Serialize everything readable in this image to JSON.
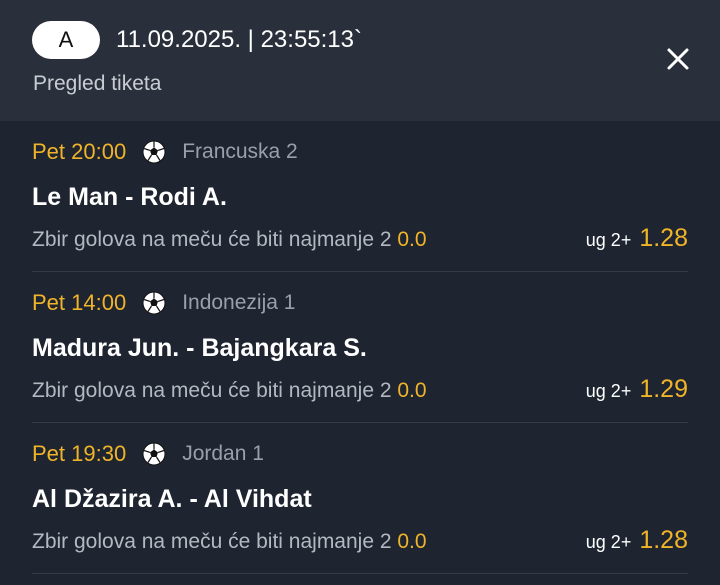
{
  "header": {
    "badge": "A",
    "datetime": "11.09.2025. | 23:55:13`",
    "subtitle": "Pregled tiketa"
  },
  "colors": {
    "accent": "#f0b429",
    "background": "#1e2430",
    "header": "#2a303b"
  },
  "icons": {
    "close": "close-icon",
    "sport": "soccer-ball-icon"
  },
  "matches": [
    {
      "time": "Pet 20:00",
      "league": "Francuska  2",
      "teams": "Le Man - Rodi A.",
      "market": "Zbir golova na meču će biti najmanje 2",
      "market_value": "0.0",
      "pick": "ug 2+",
      "odd": "1.28"
    },
    {
      "time": "Pet 14:00",
      "league": "Indonezija  1",
      "teams": "Madura Jun. - Bajangkara S.",
      "market": "Zbir golova na meču će biti najmanje 2",
      "market_value": "0.0",
      "pick": "ug 2+",
      "odd": "1.29"
    },
    {
      "time": "Pet 19:30",
      "league": "Jordan  1",
      "teams": "Al Džazira A. - Al Vihdat",
      "market": "Zbir golova na meču će biti najmanje 2",
      "market_value": "0.0",
      "pick": "ug 2+",
      "odd": "1.28"
    }
  ]
}
